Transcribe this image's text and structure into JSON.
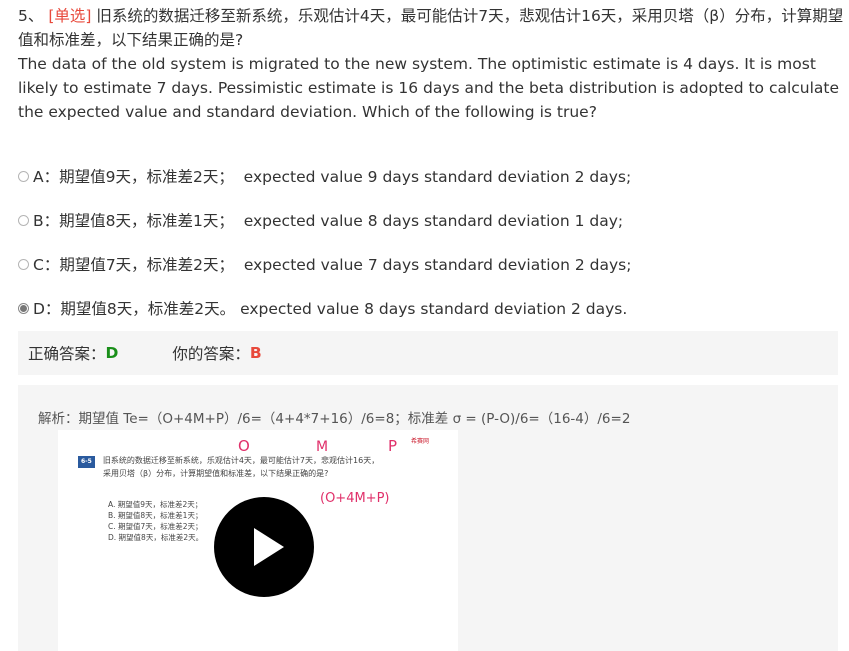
{
  "question": {
    "number": "5、",
    "type": "[单选]",
    "text_cn": "旧系统的数据迁移至新系统，乐观估计4天，最可能估计7天，悲观估计16天，采用贝塔（β）分布，计算期望值和标准差，以下结果正确的是?",
    "text_en": "The data of the old system is migrated to the new system. The optimistic estimate is 4 days. It is most likely to estimate 7 days. Pessimistic estimate is 16 days and the beta distribution is adopted to calculate the expected value and standard deviation. Which of the following is true?"
  },
  "options": [
    {
      "label": "A：期望值9天，标准差2天；  expected value 9 days standard deviation 2 days;",
      "selected": false
    },
    {
      "label": "B：期望值8天，标准差1天；  expected value 8 days standard deviation 1 day;",
      "selected": false
    },
    {
      "label": "C：期望值7天，标准差2天；  expected value 7 days standard deviation 2 days;",
      "selected": false
    },
    {
      "label": "D：期望值8天，标准差2天。 expected value 8 days standard deviation 2 days.",
      "selected": true
    }
  ],
  "answer": {
    "correct_label": "正确答案：",
    "correct_value": "D",
    "yours_label": "你的答案：",
    "yours_value": "B"
  },
  "analysis": {
    "text": "解析：期望值 Te=（O+4M+P）/6=（4+4*7+16）/6=8；标准差 σ = (P-O)/6=（16-4）/6=2"
  },
  "video": {
    "slide_badge": "6-5",
    "slide_line1": "旧系统的数据迁移至新系统，乐观估计4天，最可能估计7天，悲观估计16天，",
    "slide_line2": "采用贝塔（β）分布，计算期望值和标准差，以下结果正确的是?",
    "slide_options": [
      "A. 期望值9天，标准差2天；",
      "B. 期望值8天，标准差1天；",
      "C. 期望值7天，标准差2天；",
      "D. 期望值8天，标准差2天。"
    ],
    "annotation_o": "O",
    "annotation_m": "M",
    "annotation_p": "P",
    "annotation_formula": "(O+4M+P)",
    "logo_text": "希赛网"
  },
  "colors": {
    "question_type": "#e8493b",
    "correct": "#1a8f1a",
    "yours": "#e8493b",
    "panel_bg": "#f5f5f5",
    "annotation": "#e0306a"
  }
}
